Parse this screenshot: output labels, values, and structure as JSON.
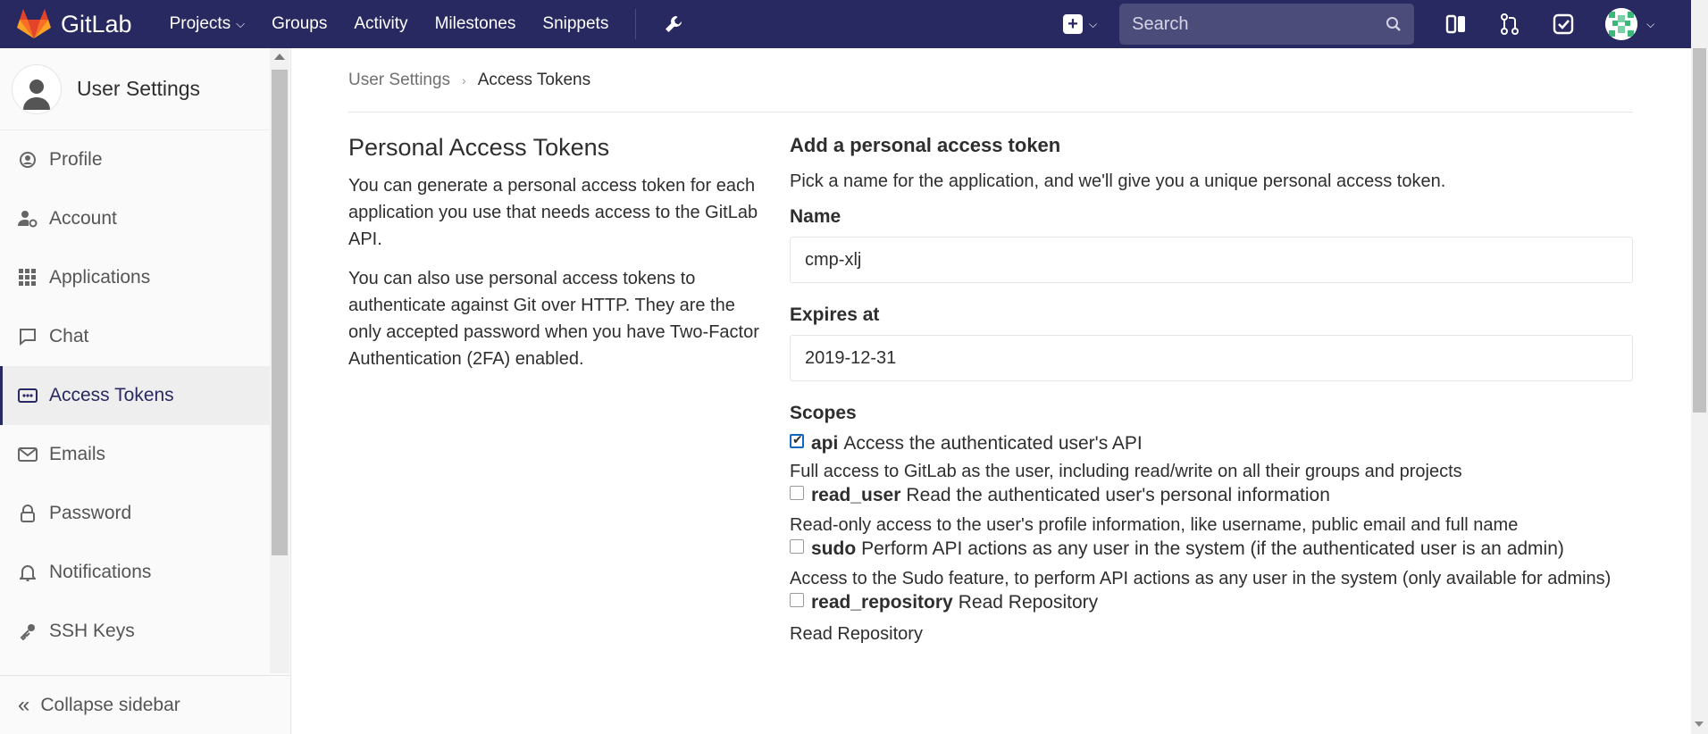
{
  "header": {
    "logo_text": "GitLab",
    "nav": {
      "projects": "Projects",
      "groups": "Groups",
      "activity": "Activity",
      "milestones": "Milestones",
      "snippets": "Snippets"
    },
    "search_placeholder": "Search"
  },
  "sidebar": {
    "title": "User Settings",
    "items": [
      {
        "label": "Profile",
        "icon": "profile-icon"
      },
      {
        "label": "Account",
        "icon": "account-icon"
      },
      {
        "label": "Applications",
        "icon": "applications-icon"
      },
      {
        "label": "Chat",
        "icon": "chat-icon"
      },
      {
        "label": "Access Tokens",
        "icon": "access-tokens-icon"
      },
      {
        "label": "Emails",
        "icon": "email-icon"
      },
      {
        "label": "Password",
        "icon": "lock-icon"
      },
      {
        "label": "Notifications",
        "icon": "bell-icon"
      },
      {
        "label": "SSH Keys",
        "icon": "key-icon"
      }
    ],
    "active": "Access Tokens",
    "collapse_label": "Collapse sidebar"
  },
  "breadcrumb": {
    "parent": "User Settings",
    "current": "Access Tokens"
  },
  "info": {
    "title": "Personal Access Tokens",
    "p1": "You can generate a personal access token for each application you use that needs access to the GitLab API.",
    "p2": "You can also use personal access tokens to authenticate against Git over HTTP. They are the only accepted password when you have Two-Factor Authentication (2FA) enabled."
  },
  "form": {
    "title": "Add a personal access token",
    "intro": "Pick a name for the application, and we'll give you a unique personal access token.",
    "name_label": "Name",
    "name_value": "cmp-xlj",
    "expires_label": "Expires at",
    "expires_value": "2019-12-31",
    "scopes_label": "Scopes",
    "scopes": [
      {
        "name": "api",
        "summary": "Access the authenticated user's API",
        "description": "Full access to GitLab as the user, including read/write on all their groups and projects",
        "checked": true
      },
      {
        "name": "read_user",
        "summary": "Read the authenticated user's personal information",
        "description": "Read-only access to the user's profile information, like username, public email and full name",
        "checked": false
      },
      {
        "name": "sudo",
        "summary": "Perform API actions as any user in the system (if the authenticated user is an admin)",
        "description": "Access to the Sudo feature, to perform API actions as any user in the system (only available for admins)",
        "checked": false
      },
      {
        "name": "read_repository",
        "summary": "Read Repository",
        "description": "Read Repository",
        "checked": false
      }
    ]
  }
}
